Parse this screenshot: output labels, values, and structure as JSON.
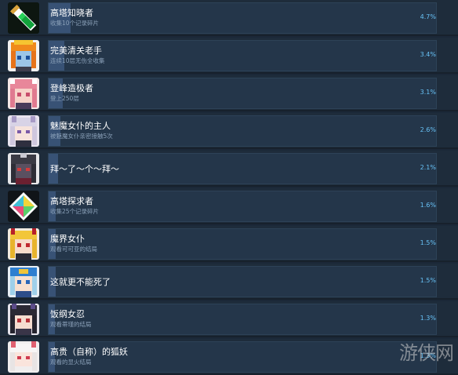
{
  "colors": {
    "background": "#1b2838",
    "row": "#1e2c3b",
    "bar_bg": "#24364a",
    "bar_fill": "#385275",
    "percent": "#67c1f5",
    "desc": "#8aa0b8"
  },
  "achievements": [
    {
      "title": "高塔知晓者",
      "desc": "收集10个记录碎片",
      "percent": "4.7%",
      "progress": 0.047,
      "icon": "green-potion-icon"
    },
    {
      "title": "完美清关老手",
      "desc": "连续10层无伤全收集",
      "percent": "3.4%",
      "progress": 0.034,
      "icon": "orange-hair-girl-icon"
    },
    {
      "title": "登峰造极者",
      "desc": "登上250层",
      "percent": "3.1%",
      "progress": 0.031,
      "icon": "pink-hair-girl-icon"
    },
    {
      "title": "魅魔女仆的主人",
      "desc": "被魅魔女仆亲密接触5次",
      "percent": "2.6%",
      "progress": 0.026,
      "icon": "white-hair-maid-icon"
    },
    {
      "title": "拜～了～个～拜～",
      "desc": "",
      "percent": "2.1%",
      "progress": 0.021,
      "icon": "dark-masked-girl-icon"
    },
    {
      "title": "高塔探求者",
      "desc": "收集25个记录碎片",
      "percent": "1.6%",
      "progress": 0.016,
      "icon": "rainbow-crystal-icon"
    },
    {
      "title": "魔界女仆",
      "desc": "观看可可亚的结局",
      "percent": "1.5%",
      "progress": 0.015,
      "icon": "blonde-demon-girl-icon"
    },
    {
      "title": "这就更不能死了",
      "desc": "",
      "percent": "1.5%",
      "progress": 0.015,
      "icon": "blue-cap-girl-icon"
    },
    {
      "title": "饭纲女忍",
      "desc": "观看蒂瑾的结局",
      "percent": "1.3%",
      "progress": 0.013,
      "icon": "black-hair-ninja-icon"
    },
    {
      "title": "高贵（自称）的狐妖",
      "desc": "观看的显火结局",
      "percent": "1.3%",
      "progress": 0.013,
      "icon": "white-fox-girl-icon"
    }
  ],
  "watermark": "游侠网"
}
